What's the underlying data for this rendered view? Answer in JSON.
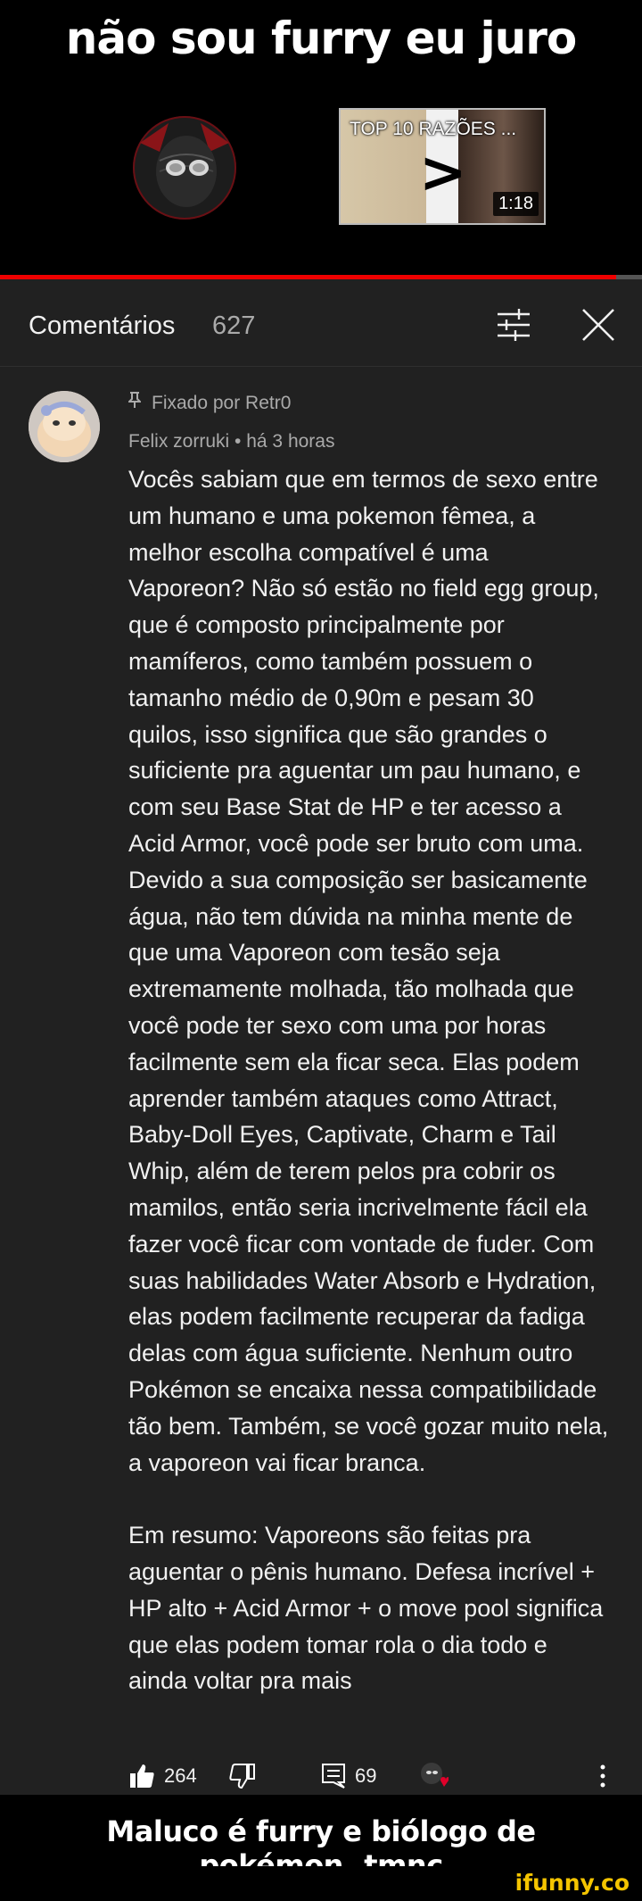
{
  "meme": {
    "title": "não sou furry eu juro",
    "video": {
      "thumbnail_title": "TOP 10 RAZÕES ...",
      "thumbnail_symbol": ">",
      "duration": "1:18",
      "progress": 0.96
    }
  },
  "comments_panel": {
    "title": "Comentários",
    "count": "627",
    "filter_icon": "sort-filter-icon",
    "close_icon": "close-icon",
    "pinned_comment": {
      "pinned_label": "Fixado por Retr0",
      "author": "Felix zorruki",
      "separator": "•",
      "time": "há 3 horas",
      "paragraphs": [
        "Vocês sabiam que em termos de sexo entre um humano e uma pokemon fêmea, a melhor escolha compatível é uma Vaporeon? Não só estão no field egg group, que é composto principalmente por mamíferos, como também possuem o tamanho médio de 0,90m e pesam 30 quilos, isso significa que são grandes o suficiente pra aguentar um pau humano, e com seu Base Stat de HP e ter acesso a Acid Armor, você pode ser bruto com uma. Devido a sua composição ser basicamente água, não tem dúvida na minha mente de que uma Vaporeon com tesão seja extremamente molhada, tão molhada que você pode ter sexo com uma por horas facilmente sem ela ficar seca. Elas podem aprender também ataques como Attract, Baby-Doll Eyes, Captivate, Charm e Tail Whip, além de terem pelos pra cobrir os mamilos, então seria incrivelmente fácil ela fazer você ficar com vontade de fuder. Com suas habilidades Water Absorb e Hydration, elas podem facilmente recuperar da fadiga delas com água suficiente. Nenhum outro Pokémon se encaixa nessa compatibilidade tão bem. Também, se você gozar muito nela, a vaporeon vai ficar branca.",
        "Em resumo: Vaporeons são feitas pra aguentar o pênis humano. Defesa incrível + HP alto + Acid Armor + o move pool significa que elas podem tomar rola o dia todo e ainda voltar pra mais"
      ],
      "likes": "264",
      "replies": "69"
    }
  },
  "caption": "Maluco é furry e biólogo de pokémon..tmnc",
  "watermark": "ifunny.co",
  "colors": {
    "panel_bg": "#212121",
    "progress_red": "#ee0000",
    "watermark_yellow": "#f4c400"
  }
}
